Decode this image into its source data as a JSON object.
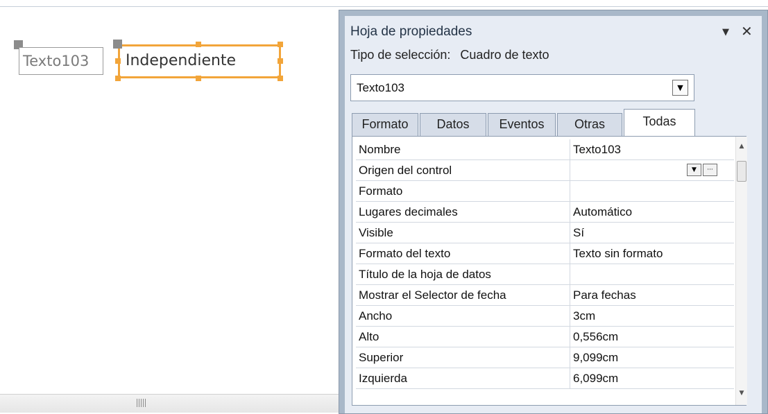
{
  "design": {
    "label_text": "Texto103",
    "textbox_text": "Independiente"
  },
  "property_sheet": {
    "title": "Hoja de propiedades",
    "menu_icon": "dropdown-triangle",
    "close_icon": "close-x",
    "selection_type_label": "Tipo de selección:",
    "selection_type_value": "Cuadro de texto",
    "object_combo_value": "Texto103",
    "tabs": [
      {
        "label": "Formato",
        "active": false
      },
      {
        "label": "Datos",
        "active": false
      },
      {
        "label": "Eventos",
        "active": false
      },
      {
        "label": "Otras",
        "active": false
      },
      {
        "label": "Todas",
        "active": true
      }
    ],
    "properties": [
      {
        "name": "Nombre",
        "value": "Texto103"
      },
      {
        "name": "Origen del control",
        "value": ""
      },
      {
        "name": "Formato",
        "value": ""
      },
      {
        "name": "Lugares decimales",
        "value": "Automático"
      },
      {
        "name": "Visible",
        "value": "Sí"
      },
      {
        "name": "Formato del texto",
        "value": "Texto sin formato"
      },
      {
        "name": "Título de la hoja de datos",
        "value": ""
      },
      {
        "name": "Mostrar el Selector de fecha",
        "value": "Para fechas"
      },
      {
        "name": "Ancho",
        "value": "3cm"
      },
      {
        "name": "Alto",
        "value": "0,556cm"
      },
      {
        "name": "Superior",
        "value": "9,099cm"
      },
      {
        "name": "Izquierda",
        "value": "6,099cm"
      }
    ]
  },
  "colors": {
    "selection_accent": "#f2a53a",
    "pane_frame": "#a9b8c9",
    "pane_background": "#e7ecf4"
  }
}
